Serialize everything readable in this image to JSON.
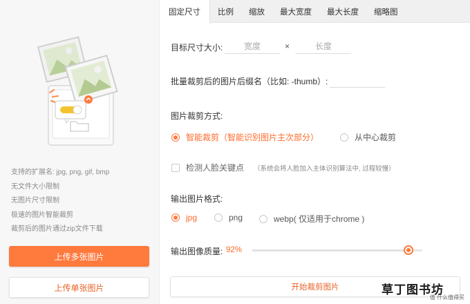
{
  "tabs": [
    {
      "label": "固定尺寸",
      "active": true
    },
    {
      "label": "比例",
      "active": false
    },
    {
      "label": "缩放",
      "active": false
    },
    {
      "label": "最大宽度",
      "active": false
    },
    {
      "label": "最大长度",
      "active": false
    },
    {
      "label": "缩略图",
      "active": false
    }
  ],
  "sidebar": {
    "info": [
      "支持的扩展名: jpg, png, gif, bmp",
      "无文件大小限制",
      "无图片尺寸限制",
      "极速的图片智能裁剪",
      "裁剪后的图片通过zip文件下载"
    ],
    "upload_multi": "上传多张图片",
    "upload_single": "上传单张图片"
  },
  "form": {
    "target_size_label": "目标尺寸大小:",
    "width_placeholder": "宽度",
    "times": "×",
    "height_placeholder": "长度",
    "suffix_label": "批量裁剪后的图片后缀名（比如: -thumb）:",
    "crop_mode_label": "图片裁剪方式:",
    "crop_modes": [
      {
        "label": "智能裁剪（智能识别图片主次部分）",
        "selected": true
      },
      {
        "label": "从中心裁剪",
        "selected": false
      }
    ],
    "face_detect_label": "检测人脸关键点",
    "face_detect_note": "（系统会将人脸加入主体识别算法中, 过程较慢）",
    "format_label": "输出图片格式:",
    "formats": [
      {
        "label": "jpg",
        "selected": true
      },
      {
        "label": "png",
        "selected": false
      },
      {
        "label": "webp( 仅适用于chrome )",
        "selected": false
      }
    ],
    "quality_label": "输出图像质量:",
    "quality_value": "92%",
    "quality_fraction": 0.92,
    "start_button": "开始裁剪图片"
  },
  "watermark": {
    "text": "草丁图书坊",
    "sub": "值 什么值得买"
  },
  "colors": {
    "accent": "#ff7a3d"
  }
}
